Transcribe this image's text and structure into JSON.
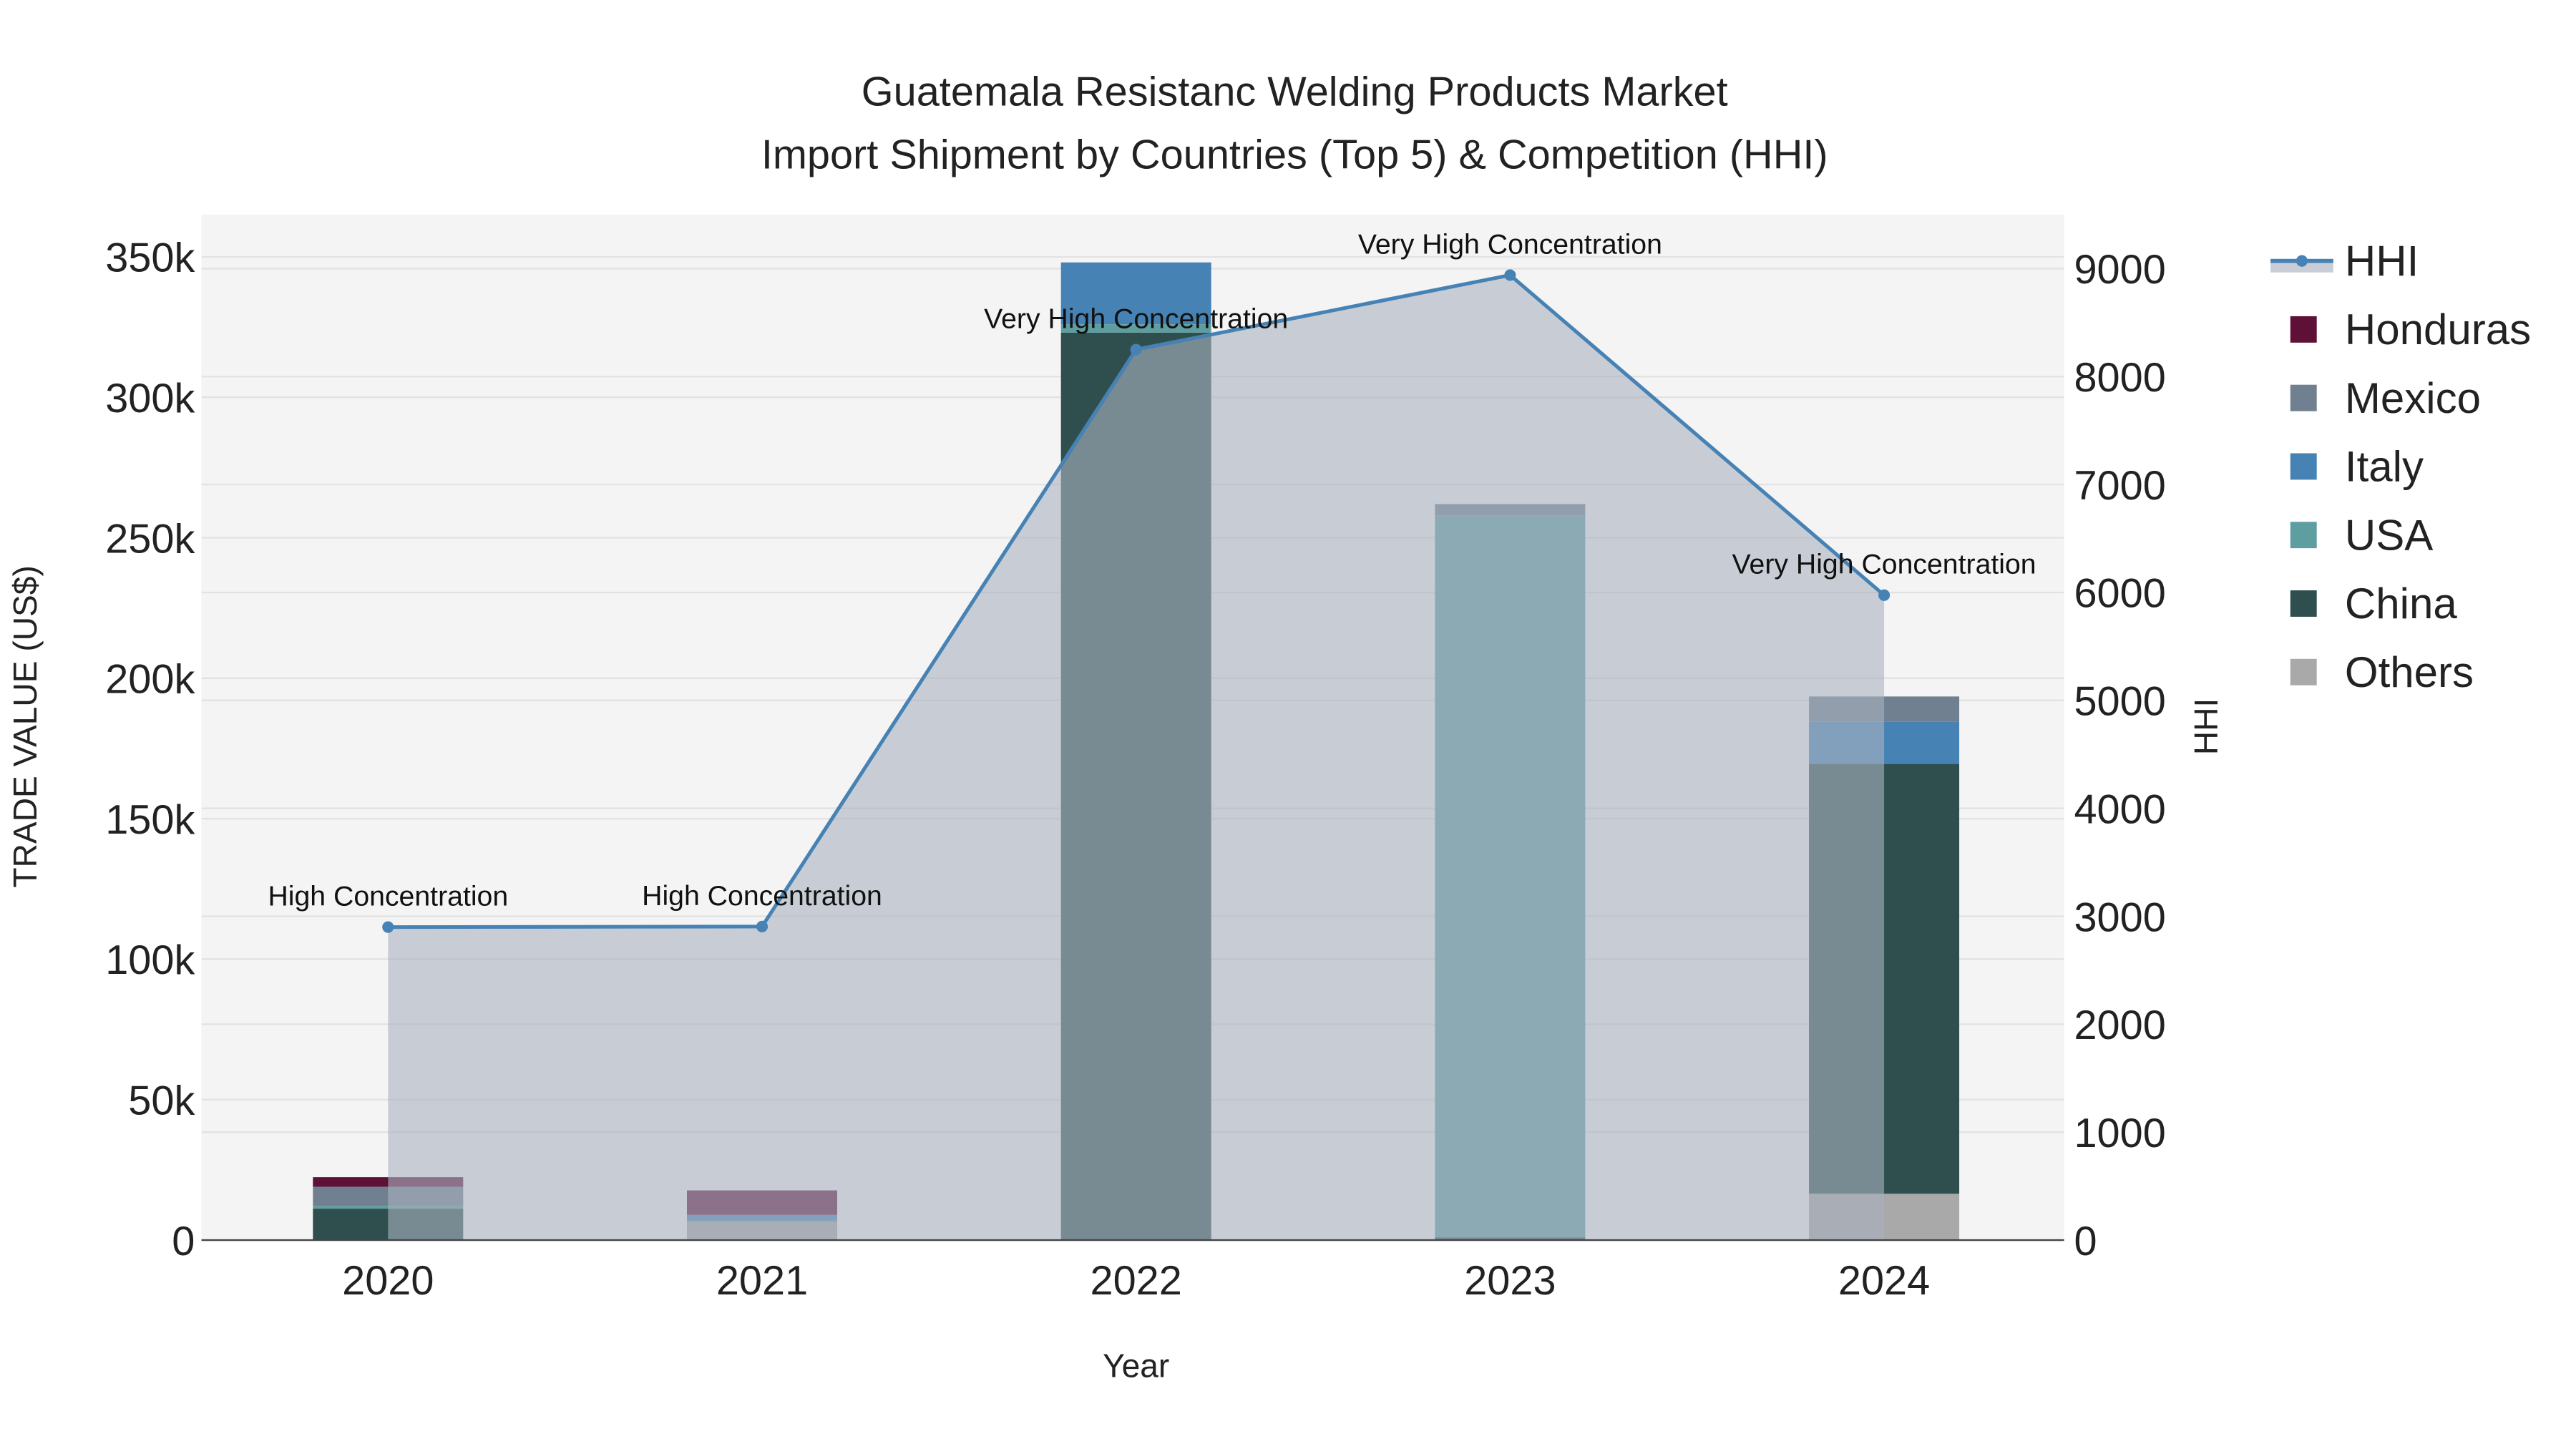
{
  "chart_data": {
    "type": "bar",
    "title_line1": "Guatemala Resistanc Welding Products Market",
    "title_line2": "Import Shipment by Countries (Top 5) & Competition (HHI)",
    "xlabel": "Year",
    "ylabel": "TRADE VALUE (US$)",
    "y2label": "HHI",
    "ylim": [
      0,
      365000
    ],
    "y2lim": [
      0,
      9500
    ],
    "yticks": [
      {
        "v": 0,
        "label": "0"
      },
      {
        "v": 50000,
        "label": "50k"
      },
      {
        "v": 100000,
        "label": "100k"
      },
      {
        "v": 150000,
        "label": "150k"
      },
      {
        "v": 200000,
        "label": "200k"
      },
      {
        "v": 250000,
        "label": "250k"
      },
      {
        "v": 300000,
        "label": "300k"
      },
      {
        "v": 350000,
        "label": "350k"
      }
    ],
    "y2ticks": [
      0,
      1000,
      2000,
      3000,
      4000,
      5000,
      6000,
      7000,
      8000,
      9000
    ],
    "categories": [
      "2020",
      "2021",
      "2022",
      "2023",
      "2024"
    ],
    "series": [
      {
        "name": "Others",
        "color": "#a9a9a9",
        "values": [
          0,
          6500,
          0,
          0,
          16500
        ]
      },
      {
        "name": "China",
        "color": "#2f4f4f",
        "values": [
          11200,
          0,
          323000,
          1000,
          153000
        ]
      },
      {
        "name": "USA",
        "color": "#5f9ea0",
        "values": [
          1000,
          500,
          3000,
          257000,
          0
        ]
      },
      {
        "name": "Italy",
        "color": "#4682b4",
        "values": [
          0,
          2000,
          22000,
          0,
          15000
        ]
      },
      {
        "name": "Mexico",
        "color": "#708090",
        "values": [
          6800,
          0,
          0,
          4000,
          9000
        ]
      },
      {
        "name": "Honduras",
        "color": "#5e1037",
        "values": [
          3400,
          8700,
          0,
          0,
          0
        ]
      }
    ],
    "hhi": {
      "name": "HHI",
      "color": "#4682b4",
      "values": [
        2900,
        2905,
        8250,
        8940,
        5975
      ],
      "labels": [
        "High Concentration",
        "High Concentration",
        "Very High Concentration",
        "Very High Concentration",
        "Very High Concentration"
      ]
    },
    "legend_order": [
      "HHI",
      "Honduras",
      "Mexico",
      "Italy",
      "USA",
      "China",
      "Others"
    ],
    "legend_placement": "right"
  }
}
